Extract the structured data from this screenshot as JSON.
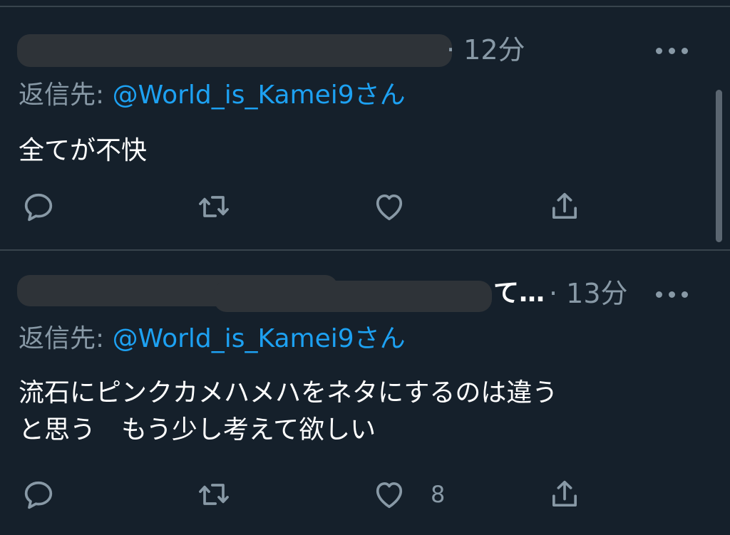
{
  "colors": {
    "background": "#15202b",
    "divider": "#38444d",
    "secondary_text": "#8899a6",
    "primary_text": "#ffffff",
    "link": "#1da1f2",
    "redaction": "#2e3338"
  },
  "tweets": [
    {
      "display_name_visible": "",
      "time": "· 12分",
      "reply_prefix": "返信先: ",
      "reply_handle": "@World_is_Kamei9さん",
      "text": "全てが不快",
      "like_count": "",
      "actions": [
        "reply-icon",
        "retweet-icon",
        "like-icon",
        "share-icon"
      ]
    },
    {
      "display_name_visible": "て…",
      "time": "· 13分",
      "reply_prefix": "返信先: ",
      "reply_handle": "@World_is_Kamei9さん",
      "text": "流石にピンクカメハメハをネタにするのは違う\nと思う　もう少し考えて欲しい",
      "like_count": "8",
      "actions": [
        "reply-icon",
        "retweet-icon",
        "like-icon",
        "share-icon"
      ]
    }
  ]
}
